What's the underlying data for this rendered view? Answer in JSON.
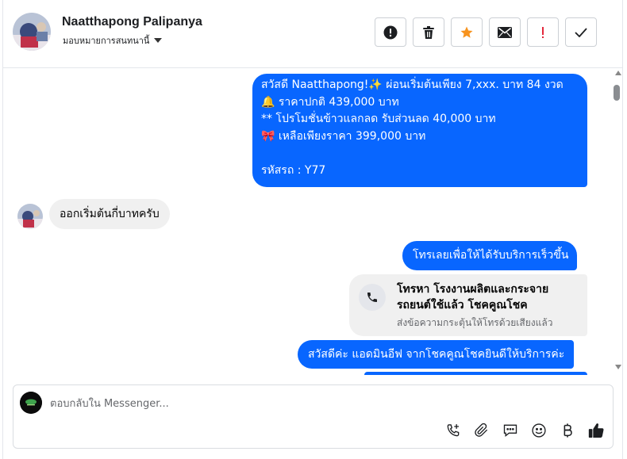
{
  "header": {
    "contact_name": "Naatthapong Palipanya",
    "assign_label": "มอบหมายการสนทนานี้",
    "toolbar": [
      {
        "name": "report-spam-button",
        "icon": "alert-circle-icon"
      },
      {
        "name": "delete-button",
        "icon": "trash-icon"
      },
      {
        "name": "star-button",
        "icon": "star-icon"
      },
      {
        "name": "mark-unread-button",
        "icon": "envelope-icon"
      },
      {
        "name": "follow-up-button",
        "icon": "exclamation-icon"
      },
      {
        "name": "mark-done-button",
        "icon": "checkmark-icon"
      }
    ],
    "colors": {
      "star": "#f7931e",
      "followup": "#e4283c"
    }
  },
  "messages": {
    "promo": {
      "lines": [
        "สวัสดี Naatthapong!✨  ผ่อนเริ่มต้นเพียง 7,xxx. บาท 84 งวด",
        "🔔 ราคาปกติ 439,000 บาท",
        "** โปรโมชั่นข้าวแลกลด รับส่วนลด 40,000 บาท",
        "🎀  เหลือเพียงราคา 399,000 บาท",
        "",
        " รหัสรถ : Y77"
      ]
    },
    "incoming_question": "ออกเริ่มต้นกี่บาทครับ",
    "call_prompt": "โทรเลยเพื่อให้ได้รับบริการเร็วขึ้น",
    "call_card": {
      "title_line1": "โทรหา โรงงานผลิตและกระจาย",
      "title_line2": "รถยนต์ใช้แล้ว โชคคูณโชค",
      "subtitle": "ส่งข้อความกระตุ้นให้โทรด้วยเสียงแล้ว"
    },
    "greeting": "สวัสดีค่ะ แอดมินอีฟ จากโชคคูณโชคยินดีให้บริการค่ะ"
  },
  "composer": {
    "placeholder": "ตอบกลับใน Messenger...",
    "actions": [
      "call-plus-icon",
      "attachment-icon",
      "saved-reply-icon",
      "emoji-icon",
      "baht-icon",
      "thumbs-up-icon"
    ],
    "accent": "#0866ff"
  }
}
